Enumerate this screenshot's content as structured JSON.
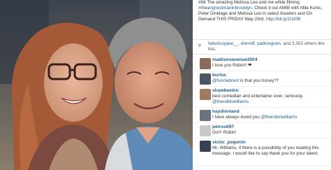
{
  "post": {
    "caption_prefix": "#tbt The amazing Melissa Leo and me while filming",
    "caption_tag": "#theangriestmaninbrooklyn",
    "caption_middle": ". Check it out AMIB with Mila Kunis, Peter Dinklage and Melissa Leo in select theaters and On Demand THIS FRIDAY May 23rd.",
    "caption_link": "http://bit.ly/1I1I0B"
  },
  "likes": {
    "names": "fabulousjaee__, donroff, pabloogram",
    "rest": ", and 3,353 others like this."
  },
  "comments": [
    {
      "user": "madisonavenue2004",
      "text": "I love you Robin!! ❤",
      "avatar_color": "#8c6a5a"
    },
    {
      "user": "kurtoc",
      "mention": "@funclebrent",
      "text": " is that you honey??",
      "avatar_color": "#4b5563"
    },
    {
      "user": "shawbeeloo",
      "text": "best comedian and entertainer ever. seriously.",
      "mention2": "@therobinwilliams",
      "avatar_color": "#a07b5e"
    },
    {
      "user": "haydionland",
      "text": "I have always loved you ",
      "mention": "@therobinwilliams",
      "avatar_color": "#6b7280"
    },
    {
      "user": "petros697",
      "text": "Go!!! Robin!",
      "avatar_color": "#c9c9c9"
    },
    {
      "user": "victor_pogonin",
      "text": "Mr. Williams, if there is a possibility of you reading this message. I would like to say thank you for your talent.",
      "avatar_color": "#374151"
    }
  ],
  "colors": {
    "link": "#1f5d8c",
    "heart": "#b8b8b8"
  }
}
